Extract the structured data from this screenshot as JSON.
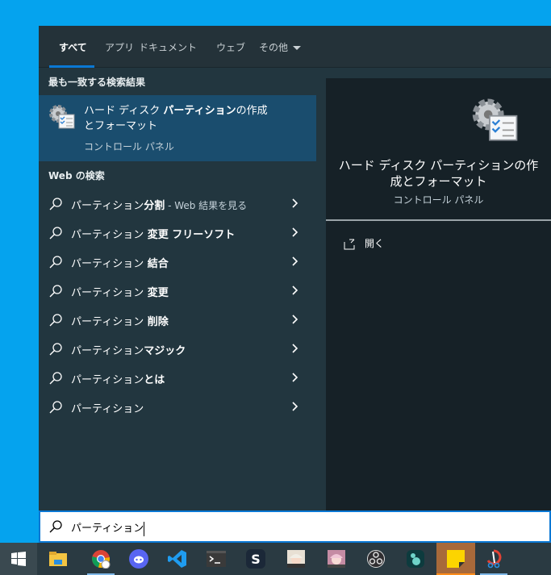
{
  "tabs": [
    {
      "label": "すべて",
      "active": true
    },
    {
      "label": "アプリ"
    },
    {
      "label": "ドキュメント"
    },
    {
      "label": "ウェブ"
    },
    {
      "label": "その他"
    }
  ],
  "best_match": {
    "heading": "最も一致する検索結果",
    "title_pre": "ハード ディスク ",
    "title_bold": "パーティション",
    "title_post": "の作成とフォーマット",
    "subtitle": "コントロール パネル",
    "icon": "disk-management-gear-icon"
  },
  "web": {
    "heading": "Web の検索",
    "items": [
      {
        "query": "パーティション",
        "suffix": "分割",
        "extra": " - Web 結果を見る"
      },
      {
        "query": "パーティション",
        "suffix": " 変更 フリーソフト"
      },
      {
        "query": "パーティション",
        "suffix": " 結合"
      },
      {
        "query": "パーティション",
        "suffix": " 変更"
      },
      {
        "query": "パーティション",
        "suffix": " 削除"
      },
      {
        "query": "パーティション",
        "suffix": "マジック"
      },
      {
        "query": "パーティション",
        "suffix": "とは"
      },
      {
        "query": "パーティション",
        "suffix": ""
      }
    ]
  },
  "preview": {
    "title": "ハード ディスク パーティションの作成とフォーマット",
    "subtitle": "コントロール パネル",
    "open_label": "開く"
  },
  "search": {
    "value": "パーティション"
  },
  "taskbar": {
    "apps": [
      "start",
      "file-explorer",
      "chrome",
      "discord",
      "vscode",
      "terminal",
      "s-app",
      "anime-avatar-1",
      "anime-avatar-2",
      "obs",
      "app-green",
      "sticky-notes",
      "snipping-tool"
    ]
  },
  "colors": {
    "accent": "#0a78d4",
    "selected": "#1a4d6e",
    "desktop": "#05a3ee"
  }
}
